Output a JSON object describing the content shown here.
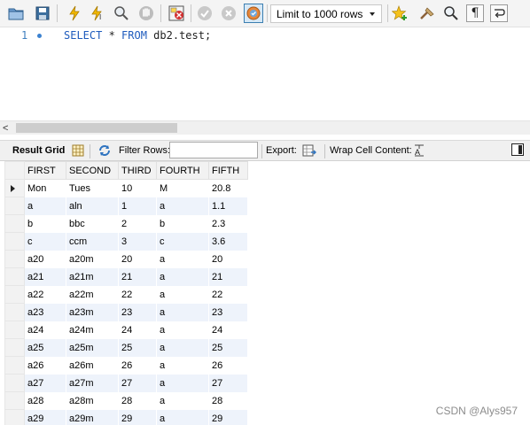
{
  "toolbar": {
    "icons": [
      "open-folder-icon",
      "save-icon",
      "execute-icon",
      "execute-current-icon",
      "explain-icon",
      "stop-icon",
      "toggle-error-icon",
      "commit-icon",
      "rollback-icon",
      "autocommit-icon",
      "beautify-icon",
      "find-icon",
      "invisible-chars-icon",
      "wrap-icon"
    ],
    "limit_select": "Limit to 1000 rows"
  },
  "editor": {
    "line_number": "1",
    "code": {
      "select": "SELECT",
      "star": " * ",
      "from": "FROM",
      "rest": " db2.test;"
    }
  },
  "result_bar": {
    "result_grid": "Result Grid",
    "filter_rows": "Filter Rows:",
    "filter_value": "",
    "export": "Export:",
    "wrap_cell": "Wrap Cell Content:"
  },
  "grid": {
    "columns": [
      "FIRST",
      "SECOND",
      "THIRD",
      "FOURTH",
      "FIFTH"
    ],
    "rows": [
      [
        "Mon",
        "Tues",
        "10",
        "M",
        "20.8"
      ],
      [
        "a",
        "aln",
        "1",
        "a",
        "1.1"
      ],
      [
        "b",
        "bbc",
        "2",
        "b",
        "2.3"
      ],
      [
        "c",
        "ccm",
        "3",
        "c",
        "3.6"
      ],
      [
        "a20",
        "a20m",
        "20",
        "a",
        "20"
      ],
      [
        "a21",
        "a21m",
        "21",
        "a",
        "21"
      ],
      [
        "a22",
        "a22m",
        "22",
        "a",
        "22"
      ],
      [
        "a23",
        "a23m",
        "23",
        "a",
        "23"
      ],
      [
        "a24",
        "a24m",
        "24",
        "a",
        "24"
      ],
      [
        "a25",
        "a25m",
        "25",
        "a",
        "25"
      ],
      [
        "a26",
        "a26m",
        "26",
        "a",
        "26"
      ],
      [
        "a27",
        "a27m",
        "27",
        "a",
        "27"
      ],
      [
        "a28",
        "a28m",
        "28",
        "a",
        "28"
      ],
      [
        "a29",
        "a29m",
        "29",
        "a",
        "29"
      ]
    ]
  },
  "watermark": "CSDN @Alys957",
  "colors": {
    "keyword": "#1e5bbd",
    "alt_row": "#eef3fb",
    "toolbar_bg": "#f4f4f4"
  }
}
